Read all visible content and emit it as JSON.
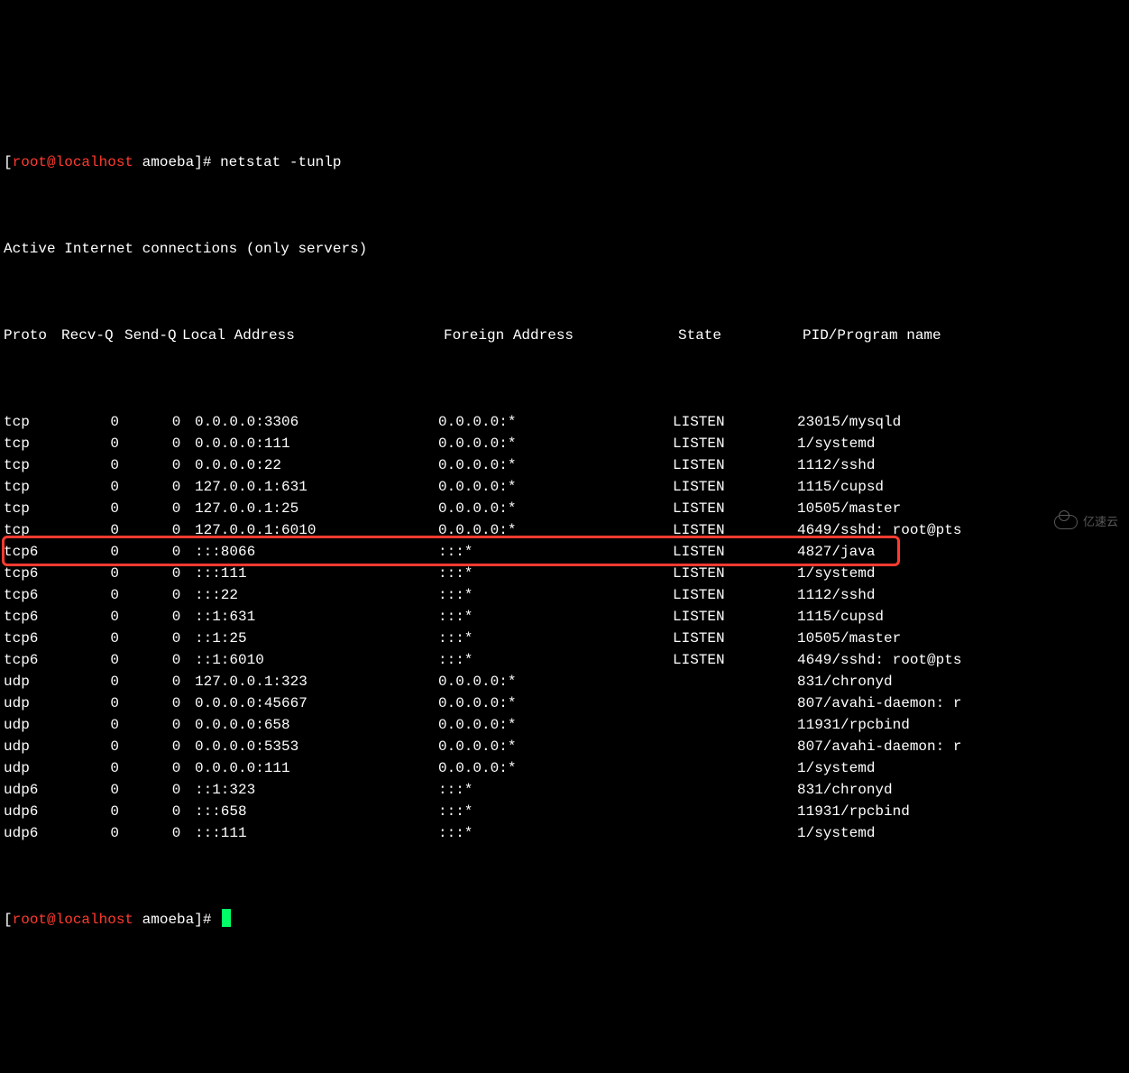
{
  "prompt": {
    "user_host": "root@localhost",
    "cwd": "amoeba",
    "command": "netstat -tunlp"
  },
  "subtitle": "Active Internet connections (only servers)",
  "headers": {
    "proto": "Proto",
    "recvq": "Recv-Q",
    "sendq": "Send-Q",
    "local": "Local Address",
    "foreign": "Foreign Address",
    "state": "State",
    "pid": "PID/Program name"
  },
  "rows": [
    {
      "proto": "tcp",
      "recvq": "0",
      "sendq": "0",
      "local": "0.0.0.0:3306",
      "foreign": "0.0.0.0:*",
      "state": "LISTEN",
      "pid": "23015/mysqld"
    },
    {
      "proto": "tcp",
      "recvq": "0",
      "sendq": "0",
      "local": "0.0.0.0:111",
      "foreign": "0.0.0.0:*",
      "state": "LISTEN",
      "pid": "1/systemd"
    },
    {
      "proto": "tcp",
      "recvq": "0",
      "sendq": "0",
      "local": "0.0.0.0:22",
      "foreign": "0.0.0.0:*",
      "state": "LISTEN",
      "pid": "1112/sshd"
    },
    {
      "proto": "tcp",
      "recvq": "0",
      "sendq": "0",
      "local": "127.0.0.1:631",
      "foreign": "0.0.0.0:*",
      "state": "LISTEN",
      "pid": "1115/cupsd"
    },
    {
      "proto": "tcp",
      "recvq": "0",
      "sendq": "0",
      "local": "127.0.0.1:25",
      "foreign": "0.0.0.0:*",
      "state": "LISTEN",
      "pid": "10505/master"
    },
    {
      "proto": "tcp",
      "recvq": "0",
      "sendq": "0",
      "local": "127.0.0.1:6010",
      "foreign": "0.0.0.0:*",
      "state": "LISTEN",
      "pid": "4649/sshd: root@pts"
    },
    {
      "proto": "tcp6",
      "recvq": "0",
      "sendq": "0",
      "local": ":::8066",
      "foreign": ":::*",
      "state": "LISTEN",
      "pid": "4827/java"
    },
    {
      "proto": "tcp6",
      "recvq": "0",
      "sendq": "0",
      "local": ":::111",
      "foreign": ":::*",
      "state": "LISTEN",
      "pid": "1/systemd"
    },
    {
      "proto": "tcp6",
      "recvq": "0",
      "sendq": "0",
      "local": ":::22",
      "foreign": ":::*",
      "state": "LISTEN",
      "pid": "1112/sshd"
    },
    {
      "proto": "tcp6",
      "recvq": "0",
      "sendq": "0",
      "local": "::1:631",
      "foreign": ":::*",
      "state": "LISTEN",
      "pid": "1115/cupsd"
    },
    {
      "proto": "tcp6",
      "recvq": "0",
      "sendq": "0",
      "local": "::1:25",
      "foreign": ":::*",
      "state": "LISTEN",
      "pid": "10505/master"
    },
    {
      "proto": "tcp6",
      "recvq": "0",
      "sendq": "0",
      "local": "::1:6010",
      "foreign": ":::*",
      "state": "LISTEN",
      "pid": "4649/sshd: root@pts"
    },
    {
      "proto": "udp",
      "recvq": "0",
      "sendq": "0",
      "local": "127.0.0.1:323",
      "foreign": "0.0.0.0:*",
      "state": "",
      "pid": "831/chronyd"
    },
    {
      "proto": "udp",
      "recvq": "0",
      "sendq": "0",
      "local": "0.0.0.0:45667",
      "foreign": "0.0.0.0:*",
      "state": "",
      "pid": "807/avahi-daemon: r"
    },
    {
      "proto": "udp",
      "recvq": "0",
      "sendq": "0",
      "local": "0.0.0.0:658",
      "foreign": "0.0.0.0:*",
      "state": "",
      "pid": "11931/rpcbind"
    },
    {
      "proto": "udp",
      "recvq": "0",
      "sendq": "0",
      "local": "0.0.0.0:5353",
      "foreign": "0.0.0.0:*",
      "state": "",
      "pid": "807/avahi-daemon: r"
    },
    {
      "proto": "udp",
      "recvq": "0",
      "sendq": "0",
      "local": "0.0.0.0:111",
      "foreign": "0.0.0.0:*",
      "state": "",
      "pid": "1/systemd"
    },
    {
      "proto": "udp6",
      "recvq": "0",
      "sendq": "0",
      "local": "::1:323",
      "foreign": ":::*",
      "state": "",
      "pid": "831/chronyd"
    },
    {
      "proto": "udp6",
      "recvq": "0",
      "sendq": "0",
      "local": ":::658",
      "foreign": ":::*",
      "state": "",
      "pid": "11931/rpcbind"
    },
    {
      "proto": "udp6",
      "recvq": "0",
      "sendq": "0",
      "local": ":::111",
      "foreign": ":::*",
      "state": "",
      "pid": "1/systemd"
    }
  ],
  "highlight_row_index": 6,
  "prompt2": {
    "user_host": "root@localhost",
    "cwd": "amoeba"
  },
  "watermark": "亿速云"
}
